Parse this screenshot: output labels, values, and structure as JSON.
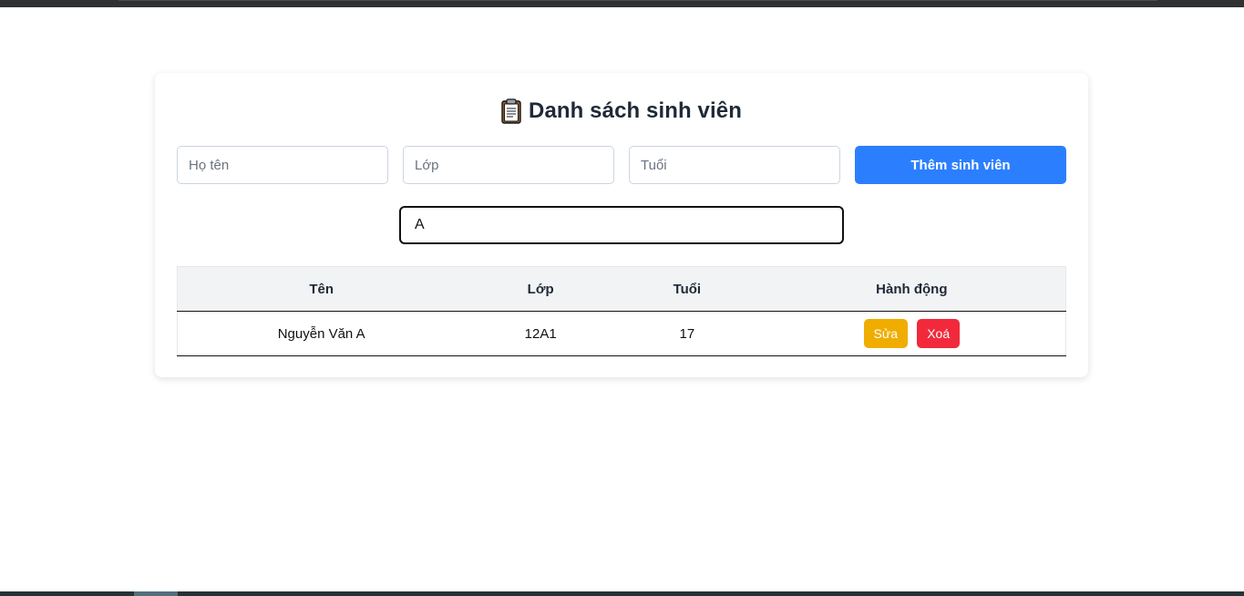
{
  "page": {
    "title": "Danh sách sinh viên",
    "title_icon": "clipboard-icon"
  },
  "form": {
    "name_placeholder": "Họ tên",
    "class_placeholder": "Lớp",
    "age_placeholder": "Tuổi",
    "add_label": "Thêm sinh viên",
    "accent_color": "#2b7fff"
  },
  "search": {
    "value": "A"
  },
  "table": {
    "headers": [
      "Tên",
      "Lớp",
      "Tuổi",
      "Hành động"
    ],
    "rows": [
      {
        "name": "Nguyễn Văn A",
        "class": "12A1",
        "age": "17",
        "edit_label": "Sửa",
        "delete_label": "Xoá"
      }
    ]
  },
  "colors": {
    "edit": "#f0ad00",
    "delete": "#f2293b"
  }
}
